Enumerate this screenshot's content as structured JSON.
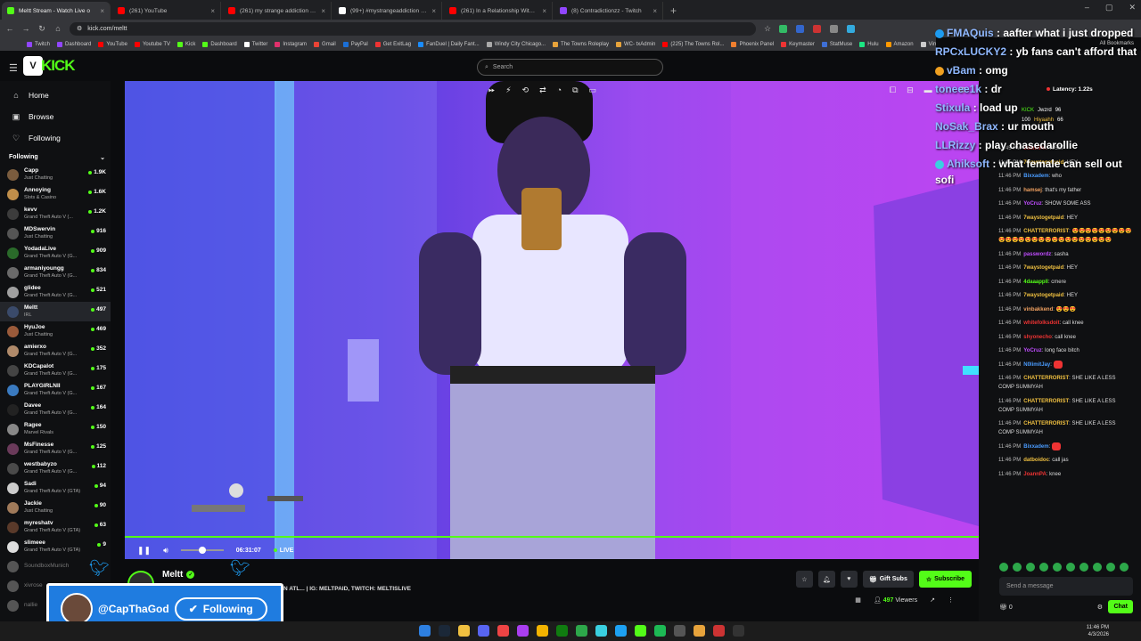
{
  "browser": {
    "tabs": [
      {
        "title": "Meltt Stream - Watch Live o",
        "color": "#53fc18",
        "active": true
      },
      {
        "title": "(261) YouTube",
        "color": "#ff0000",
        "active": false
      },
      {
        "title": "(261) my strange addiction - Yo",
        "color": "#ff0000",
        "active": false
      },
      {
        "title": "(99+) #mystrangeaddiction #sh",
        "color": "#ffffff",
        "active": false
      },
      {
        "title": "(261) In a Relationship With Hi",
        "color": "#ff0000",
        "active": false
      },
      {
        "title": "(8) Contradictionzz - Twitch",
        "color": "#9146ff",
        "active": false
      }
    ],
    "url": "kick.com/meltt",
    "bookmarks": [
      {
        "label": "Twitch",
        "color": "#9146ff"
      },
      {
        "label": "Dashboard",
        "color": "#9146ff"
      },
      {
        "label": "YouTube",
        "color": "#ff0000"
      },
      {
        "label": "Youtube TV",
        "color": "#ff0000"
      },
      {
        "label": "Kick",
        "color": "#53fc18"
      },
      {
        "label": "Dashboard",
        "color": "#53fc18"
      },
      {
        "label": "Twitter",
        "color": "#ffffff"
      },
      {
        "label": "Instagram",
        "color": "#e1306c"
      },
      {
        "label": "Gmail",
        "color": "#ea4335"
      },
      {
        "label": "PayPal",
        "color": "#1b6fd6"
      },
      {
        "label": "Get ExitLag",
        "color": "#e33"
      },
      {
        "label": "FanDuel | Daily Fant...",
        "color": "#1a8cff"
      },
      {
        "label": "Windy City Chicago...",
        "color": "#aaaaaa"
      },
      {
        "label": "The Towns Roleplay",
        "color": "#e7a33b"
      },
      {
        "label": "WC- txAdmin",
        "color": "#e7a33b"
      },
      {
        "label": "(225) The Towns Rol...",
        "color": "#ff0000"
      },
      {
        "label": "Phoenix Panel",
        "color": "#f07f2f"
      },
      {
        "label": "Keymaster",
        "color": "#e33"
      },
      {
        "label": "StatMuse",
        "color": "#3e6fd6"
      },
      {
        "label": "Hulu",
        "color": "#1ce783"
      },
      {
        "label": "Amazon",
        "color": "#ff9900"
      },
      {
        "label": "Vimmi's Lair: PS2 Va...",
        "color": "#cccccc"
      }
    ],
    "all_bookmarks": "All Bookmarks"
  },
  "kick": {
    "logo": "KICK",
    "search_placeholder": "Search",
    "nav": [
      {
        "label": "Home",
        "icon": "home-icon",
        "glyph": "⌂"
      },
      {
        "label": "Browse",
        "icon": "browse-icon",
        "glyph": "▣"
      },
      {
        "label": "Following",
        "icon": "heart-icon",
        "glyph": "♡"
      }
    ],
    "following_title": "Following",
    "channels": [
      {
        "name": "Capp",
        "cat": "Just Chatting",
        "viewers": "1.9K",
        "color": "#7a5c3e"
      },
      {
        "name": "Annoying",
        "cat": "Slots & Casino",
        "viewers": "1.6K",
        "color": "#c08e4a"
      },
      {
        "name": "kevv",
        "cat": "Grand Theft Auto V (...",
        "viewers": "1.2K",
        "color": "#3c3c3c"
      },
      {
        "name": "MDSwervin",
        "cat": "Just Chatting",
        "viewers": "916",
        "color": "#555"
      },
      {
        "name": "YodadaLive",
        "cat": "Grand Theft Auto V (G...",
        "viewers": "909",
        "color": "#2a6a2a"
      },
      {
        "name": "armaniyoungg",
        "cat": "Grand Theft Auto V (G...",
        "viewers": "834",
        "color": "#6a6a6a"
      },
      {
        "name": "glidee",
        "cat": "Grand Theft Auto V (G...",
        "viewers": "521",
        "color": "#a0a0a0"
      },
      {
        "name": "Meltt",
        "cat": "IRL",
        "viewers": "497",
        "color": "#3a4a6a",
        "selected": true
      },
      {
        "name": "HyuJoe",
        "cat": "Just Chatting",
        "viewers": "469",
        "color": "#9a5a3a"
      },
      {
        "name": "amierxo",
        "cat": "Grand Theft Auto V (G...",
        "viewers": "352",
        "color": "#b08a6a"
      },
      {
        "name": "KDCapalot",
        "cat": "Grand Theft Auto V (G...",
        "viewers": "175",
        "color": "#444"
      },
      {
        "name": "PLAYGIRLNII",
        "cat": "Grand Theft Auto V (G...",
        "viewers": "167",
        "color": "#3a7ac0"
      },
      {
        "name": "Davee",
        "cat": "Grand Theft Auto V (G...",
        "viewers": "164",
        "color": "#222"
      },
      {
        "name": "Ragee",
        "cat": "Marvel Rivals",
        "viewers": "150",
        "color": "#888"
      },
      {
        "name": "MsFinesse",
        "cat": "Grand Theft Auto V (G...",
        "viewers": "125",
        "color": "#6a3a5a"
      },
      {
        "name": "westbabyzo",
        "cat": "Grand Theft Auto V (G...",
        "viewers": "112",
        "color": "#4a4a4a"
      },
      {
        "name": "Sadi",
        "cat": "Grand Theft Auto V (GTA)",
        "viewers": "94",
        "color": "#ccc"
      },
      {
        "name": "Jackie",
        "cat": "Just Chatting",
        "viewers": "90",
        "color": "#a07a5a"
      },
      {
        "name": "myreshatv",
        "cat": "Grand Theft Auto V (GTA)",
        "viewers": "63",
        "color": "#5a3a2a"
      },
      {
        "name": "slimeee",
        "cat": "Grand Theft Auto V (GTA)",
        "viewers": "9",
        "color": "#ddd"
      },
      {
        "name": "SoundboxMunich",
        "cat": "",
        "viewers": "",
        "color": "#555",
        "offline": true
      },
      {
        "name": "xivrose",
        "cat": "",
        "viewers": "",
        "color": "#555",
        "offline": true
      },
      {
        "name": "nallie",
        "cat": "",
        "viewers": "",
        "color": "#555",
        "offline": true
      }
    ]
  },
  "player": {
    "time": "06:31:07",
    "live": "LIVE"
  },
  "stream": {
    "streamer": "Meltt",
    "title_fragment": "S IN ATL... | IG: MELTPAID, TWITCH: MELTISLIVE",
    "gift_subs": "Gift Subs",
    "subscribe": "Subscribe",
    "viewers": "497",
    "viewers_label": "Viewers"
  },
  "overlay": {
    "name": "@CapThaGod",
    "button": "Following"
  },
  "bigchat": [
    {
      "user": "FMAQuis",
      "text": "aafter what i just dropped",
      "icon": "#1d9bf0"
    },
    {
      "user": "RPCxLUCKY2",
      "text": "yb fans can't afford that",
      "icon": ""
    },
    {
      "user": "vBam",
      "text": "omg",
      "icon": "#f0a020"
    },
    {
      "user": "toneee1k",
      "text": "dr",
      "icon": ""
    },
    {
      "user": "Stixula",
      "text": "load up",
      "icon": ""
    },
    {
      "user": "NoSak_Brax",
      "text": "ur mouth",
      "icon": ""
    },
    {
      "user": "LLRizzy",
      "text": "play chasedarollie",
      "icon": ""
    },
    {
      "user": "Ahiksoft",
      "text": "what female can sell out sofi",
      "icon": "#3ad0e0"
    }
  ],
  "chat": {
    "latency": "Latency: 1.22s",
    "leaderboard": [
      {
        "a": "KICK",
        "b": "Jwzrd",
        "c": "96"
      },
      {
        "a": "100",
        "b": "Hiyaahh",
        "c": "66"
      }
    ],
    "messages": [
      {
        "t": "11:45 PM",
        "u": "JoannPA",
        "c": "#e33",
        "m": "WSSP"
      },
      {
        "t": "11:45 PM",
        "u": "7waystogetpaid",
        "c": "#f0c040",
        "m": "HEY"
      },
      {
        "t": "11:46 PM",
        "u": "Bixxadem",
        "c": "#4a9cff",
        "m": "who"
      },
      {
        "t": "11:46 PM",
        "u": "hamsej",
        "c": "#f0a060",
        "m": "that's my father"
      },
      {
        "t": "11:46 PM",
        "u": "YoCruz",
        "c": "#c04cff",
        "m": "SHOW SOME ASS"
      },
      {
        "t": "11:46 PM",
        "u": "7waystogetpaid",
        "c": "#f0c040",
        "m": "HEY"
      },
      {
        "t": "11:46 PM",
        "u": "CHATTERRORIST",
        "c": "#f0c040",
        "m": "😍😍😍😍😍😍😍😍😍😍😍😍😍😍😍😍😍😍😍😍😍😍😍😍😍😍"
      },
      {
        "t": "11:46 PM",
        "u": "passwordz",
        "c": "#c04cff",
        "m": "sasha"
      },
      {
        "t": "11:46 PM",
        "u": "7waystogetpaid",
        "c": "#f0c040",
        "m": "HEY"
      },
      {
        "t": "11:46 PM",
        "u": "4daaappll",
        "c": "#53fc18",
        "m": "cmere"
      },
      {
        "t": "11:46 PM",
        "u": "7waystogetpaid",
        "c": "#f0c040",
        "m": "HEY"
      },
      {
        "t": "11:46 PM",
        "u": "vinbakkend",
        "c": "#f0a060",
        "m": "😍😍😍"
      },
      {
        "t": "11:46 PM",
        "u": "whitefolksdoit",
        "c": "#e33",
        "m": "call knee"
      },
      {
        "t": "11:46 PM",
        "u": "shyonecho",
        "c": "#e33",
        "m": "call knee"
      },
      {
        "t": "11:46 PM",
        "u": "YoCruz",
        "c": "#c04cff",
        "m": "long face bitch"
      },
      {
        "t": "11:46 PM",
        "u": "N0limitJay",
        "c": "#4a9cff",
        "m": ""
      },
      {
        "t": "11:46 PM",
        "u": "CHATTERRORIST",
        "c": "#f0c040",
        "m": "SHE LIKE A LESS COMP SUMMYAH"
      },
      {
        "t": "11:46 PM",
        "u": "CHATTERRORIST",
        "c": "#f0c040",
        "m": "SHE LIKE A LESS COMP SUMMYAH"
      },
      {
        "t": "11:46 PM",
        "u": "CHATTERRORIST",
        "c": "#f0c040",
        "m": "SHE LIKE A LESS COMP SUMMYAH"
      },
      {
        "t": "11:46 PM",
        "u": "Bixxadem",
        "c": "#4a9cff",
        "m": ""
      },
      {
        "t": "11:46 PM",
        "u": "datboidoc",
        "c": "#f0c040",
        "m": "call jas"
      },
      {
        "t": "11:46 PM",
        "u": "JoannPA",
        "c": "#e33",
        "m": "knee"
      }
    ],
    "input_placeholder": "Send a message",
    "points": "0",
    "chat_button": "Chat"
  },
  "taskbar": {
    "time": "11:46 PM",
    "date": "4/3/2026"
  }
}
